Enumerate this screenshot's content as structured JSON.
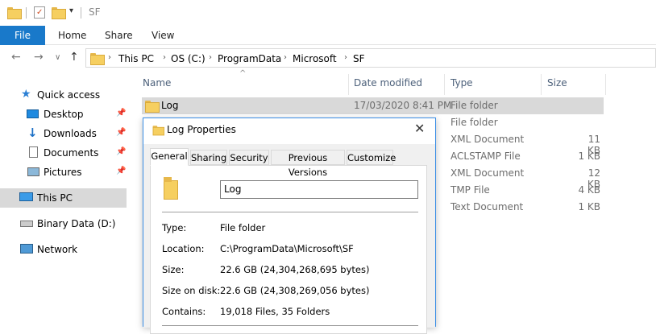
{
  "window": {
    "title": "SF"
  },
  "ribbon": {
    "tabs": [
      "File",
      "Home",
      "Share",
      "View"
    ]
  },
  "address": {
    "crumbs": [
      "This PC",
      "OS (C:)",
      "ProgramData",
      "Microsoft",
      "SF"
    ]
  },
  "nav": {
    "quick_access": "Quick access",
    "items": [
      "Desktop",
      "Downloads",
      "Documents",
      "Pictures"
    ],
    "this_pc": "This PC",
    "binary": "Binary Data (D:)",
    "network": "Network"
  },
  "columns": [
    "Name",
    "Date modified",
    "Type",
    "Size"
  ],
  "files": [
    {
      "name": "Log",
      "date": "17/03/2020 8:41 PM",
      "type": "File folder",
      "size": ""
    },
    {
      "name": "",
      "date": "",
      "type": "File folder",
      "size": ""
    },
    {
      "name": "",
      "date": "",
      "type": "XML Document",
      "size": "11 KB"
    },
    {
      "name": "",
      "date": "",
      "type": "ACLSTAMP File",
      "size": "1 KB"
    },
    {
      "name": "",
      "date": "",
      "type": "XML Document",
      "size": "12 KB"
    },
    {
      "name": "",
      "date": "",
      "type": "TMP File",
      "size": "4 KB"
    },
    {
      "name": "",
      "date": "",
      "type": "Text Document",
      "size": "1 KB"
    }
  ],
  "dialog": {
    "title": "Log Properties",
    "tabs": [
      "General",
      "Sharing",
      "Security",
      "Previous Versions",
      "Customize"
    ],
    "name_value": "Log",
    "props": {
      "type_label": "Type:",
      "type_value": "File folder",
      "location_label": "Location:",
      "location_value": "C:\\ProgramData\\Microsoft\\SF",
      "size_label": "Size:",
      "size_value": "22.6 GB (24,304,268,695 bytes)",
      "size_on_disk_label": "Size on disk:",
      "size_on_disk_value": "22.6 GB (24,308,269,056 bytes)",
      "contains_label": "Contains:",
      "contains_value": "19,018 Files, 35 Folders"
    }
  },
  "colors": {
    "accent": "#1979ca",
    "selection": "#d9d9d9",
    "folder": "#f6cf60"
  }
}
